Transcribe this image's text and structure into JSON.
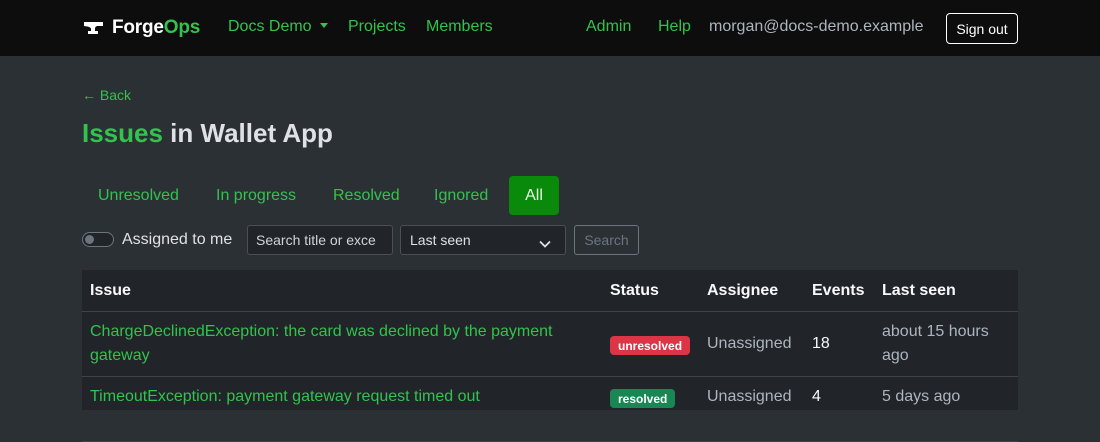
{
  "navbar": {
    "brand_primary": "Forge",
    "brand_accent": "Ops",
    "org_menu_label": "Docs Demo",
    "projects_label": "Projects",
    "members_label": "Members",
    "admin_label": "Admin",
    "help_label": "Help",
    "user_email": "morgan@docs-demo.example",
    "signout_label": "Sign out"
  },
  "page": {
    "back_label": "← Back",
    "title_highlight": "Issues",
    "title_rest": " in Wallet App"
  },
  "tabs": [
    {
      "label": "Unresolved",
      "active": false
    },
    {
      "label": "In progress",
      "active": false
    },
    {
      "label": "Resolved",
      "active": false
    },
    {
      "label": "Ignored",
      "active": false
    },
    {
      "label": "All",
      "active": true
    }
  ],
  "filters": {
    "assigned_to_me_label": "Assigned to me",
    "assigned_to_me_on": false,
    "search_placeholder": "Search title or exce",
    "search_value": "",
    "sort_selected": "Last seen",
    "search_button_label": "Search"
  },
  "table": {
    "columns": [
      "Issue",
      "Status",
      "Assignee",
      "Events",
      "Last seen"
    ],
    "rows": [
      {
        "issue": "ChargeDeclinedException: the card was declined by the payment gateway",
        "status": "unresolved",
        "assignee": "Unassigned",
        "events": "18",
        "last_seen": "about 15 hours ago"
      },
      {
        "issue": "TimeoutException: payment gateway request timed out",
        "status": "resolved",
        "assignee": "Unassigned",
        "events": "4",
        "last_seen": "5 days ago"
      }
    ]
  },
  "colors": {
    "accent": "#33c24d",
    "unresolved_badge": "#dc3545",
    "resolved_badge": "#198754",
    "active_tab": "#0a8a0a"
  },
  "icons": {
    "brand": "anvil-icon",
    "org_menu": "caret-down-icon",
    "toggle": "toggle-switch",
    "select": "chevron-down-icon"
  }
}
